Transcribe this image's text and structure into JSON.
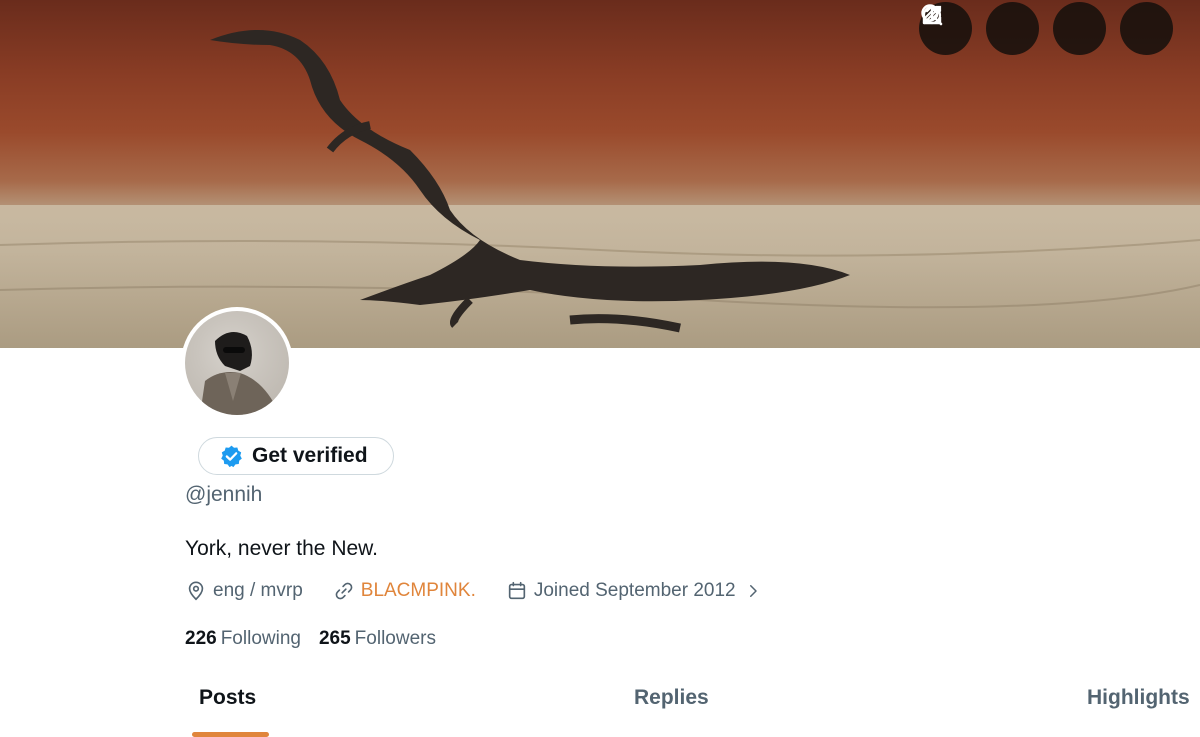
{
  "top_actions": [
    {
      "icon": "nostr-icon"
    },
    {
      "icon": "search-icon"
    },
    {
      "icon": "edit-icon"
    },
    {
      "icon": "share-icon"
    }
  ],
  "profile": {
    "verify_label": "Get verified",
    "handle": "@jennih",
    "bio": "York, never the New.",
    "location": "eng / mvrp",
    "website": "BLACMPINK.",
    "joined": "Joined September 2012",
    "following_count": "226",
    "following_label": "Following",
    "followers_count": "265",
    "followers_label": "Followers"
  },
  "tabs": [
    {
      "label": "Posts",
      "active": true
    },
    {
      "label": "Replies",
      "active": false
    },
    {
      "label": "Highlights",
      "active": false
    }
  ],
  "colors": {
    "accent": "#e0853b",
    "verified_badge": "#1d9bf0",
    "muted_text": "#536471"
  }
}
